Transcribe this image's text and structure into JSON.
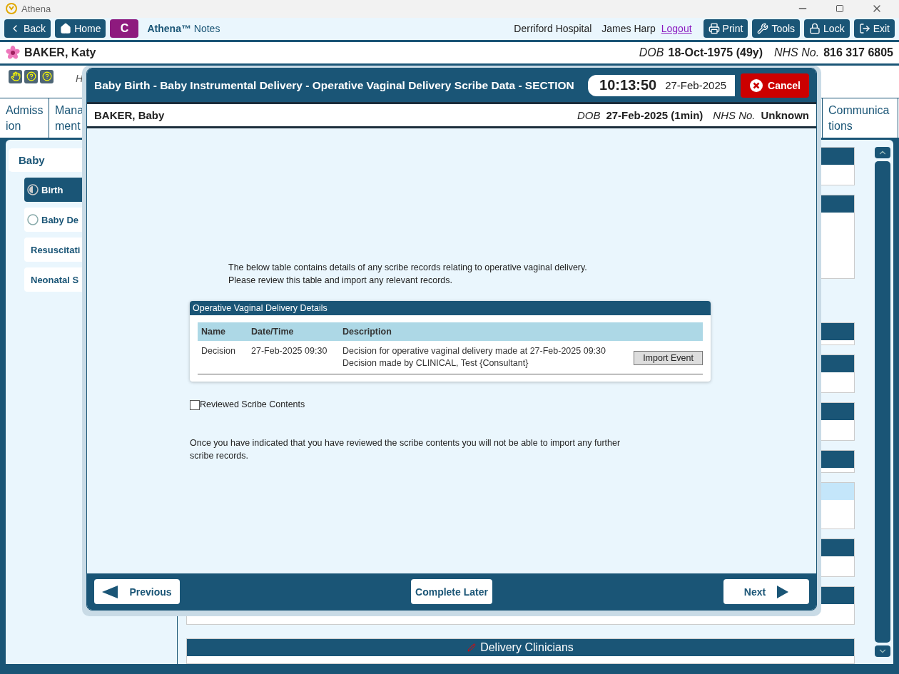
{
  "window": {
    "title": "Athena"
  },
  "toolbar": {
    "buttons": [
      {
        "kind": "back",
        "label": "Back"
      },
      {
        "kind": "home",
        "label": "Home"
      }
    ],
    "badge": "C",
    "app_name": "Athena™",
    "app_suffix": "Notes",
    "hospital": "Derriford Hospital",
    "user": "James Harp",
    "logout": "Logout",
    "actions": [
      {
        "kind": "print",
        "label": "Print"
      },
      {
        "kind": "tools",
        "label": "Tools"
      },
      {
        "kind": "lock",
        "label": "Lock"
      },
      {
        "kind": "exit",
        "label": "Exit"
      }
    ]
  },
  "patient": {
    "name": "BAKER, Katy",
    "dob_label": "DOB",
    "dob": "18-Oct-1975 (49y)",
    "nhs_label": "NHS No.",
    "nhs": "816 317 6805"
  },
  "subheading": "H",
  "tabs": [
    {
      "lines": [
        "Admiss",
        "ion"
      ],
      "selected": false
    },
    {
      "lines": [
        "Mana",
        "ment"
      ],
      "selected": false
    }
  ],
  "tabs_right": [
    {
      "lines": [
        "Communica",
        "tions"
      ],
      "selected": false
    }
  ],
  "sidebar": {
    "group": "Baby",
    "items": [
      {
        "label": "Birth",
        "selected": true,
        "kind": "partial"
      },
      {
        "label": "Baby De",
        "selected": false,
        "kind": "empty"
      },
      {
        "label": "Resuscitati",
        "selected": false,
        "kind": "plain"
      },
      {
        "label": "Neonatal S",
        "selected": false,
        "kind": "plain"
      }
    ]
  },
  "sections": [
    {
      "kind": "short"
    },
    {
      "kind": "tall"
    },
    {
      "kind": "bar"
    },
    {
      "kind": "short"
    },
    {
      "kind": "short"
    },
    {
      "kind": "bar"
    },
    {
      "kind": "light"
    },
    {
      "kind": "short"
    },
    {
      "kind": "short"
    },
    {
      "kind": "titled",
      "title": "Delivery Clinicians"
    }
  ],
  "dialog": {
    "title": "Baby Birth - Baby Instrumental Delivery - Operative Vaginal Delivery Scribe Data - SECTION",
    "time": "10:13:50",
    "date": "27-Feb-2025",
    "cancel": "Cancel",
    "patient": {
      "name": "BAKER, Baby",
      "dob_label": "DOB",
      "dob": "27-Feb-2025 (1min)",
      "nhs_label": "NHS No.",
      "nhs": "Unknown"
    },
    "intro": [
      "The below table contains details of any scribe records relating to operative vaginal delivery.",
      "Please review this table and import any relevant records."
    ],
    "card": {
      "title": "Operative Vaginal Delivery Details",
      "columns": [
        "Name",
        "Date/Time",
        "Description"
      ],
      "rows": [
        {
          "name": "Decision",
          "datetime": "27-Feb-2025 09:30",
          "description": [
            "Decision for operative vaginal delivery made at 27-Feb-2025 09:30",
            "Decision made by CLINICAL, Test {Consultant}"
          ],
          "action": "Import Event"
        }
      ]
    },
    "checkbox": {
      "label": "Reviewed Scribe Contents",
      "checked": false
    },
    "note": "Once you have indicated that you have reviewed the scribe contents you will not be able to import any further scribe records.",
    "footer": {
      "previous": "Previous",
      "later": "Complete Later",
      "next": "Next"
    }
  }
}
